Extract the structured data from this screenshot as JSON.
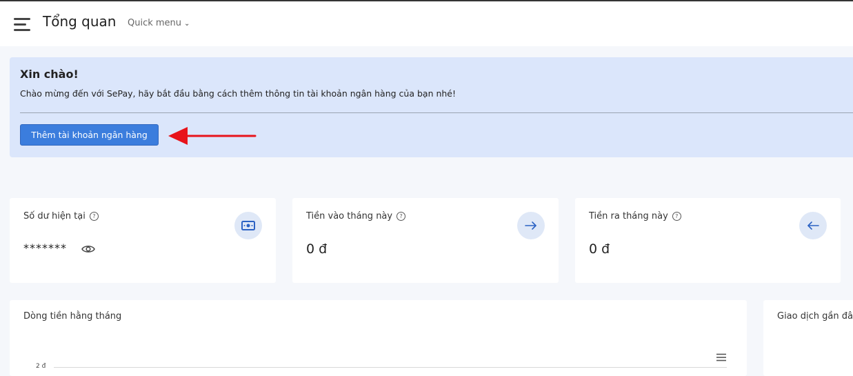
{
  "header": {
    "title": "Tổng quan",
    "quick_menu_label": "Quick menu"
  },
  "welcome": {
    "title": "Xin chào!",
    "message": "Chào mừng đến với SePay, hãy bắt đầu bằng cách thêm thông tin tài khoản ngân hàng của bạn nhé!",
    "button_label": "Thêm tài khoản ngân hàng"
  },
  "stats": [
    {
      "label": "Số dư hiện tại",
      "value": "*******",
      "icon": "money-icon"
    },
    {
      "label": "Tiền vào tháng này",
      "value": "0 đ",
      "icon": "arrow-right-icon"
    },
    {
      "label": "Tiền ra tháng này",
      "value": "0 đ",
      "icon": "arrow-left-icon"
    }
  ],
  "cash_flow": {
    "title": "Dòng tiền hằng tháng",
    "y_tick": "2 đ"
  },
  "recent": {
    "title": "Giao dịch gần đây"
  },
  "colors": {
    "accent": "#3b7ddd",
    "alert_bg": "#dbe6fb",
    "arrow_annotation": "#e8131a"
  }
}
